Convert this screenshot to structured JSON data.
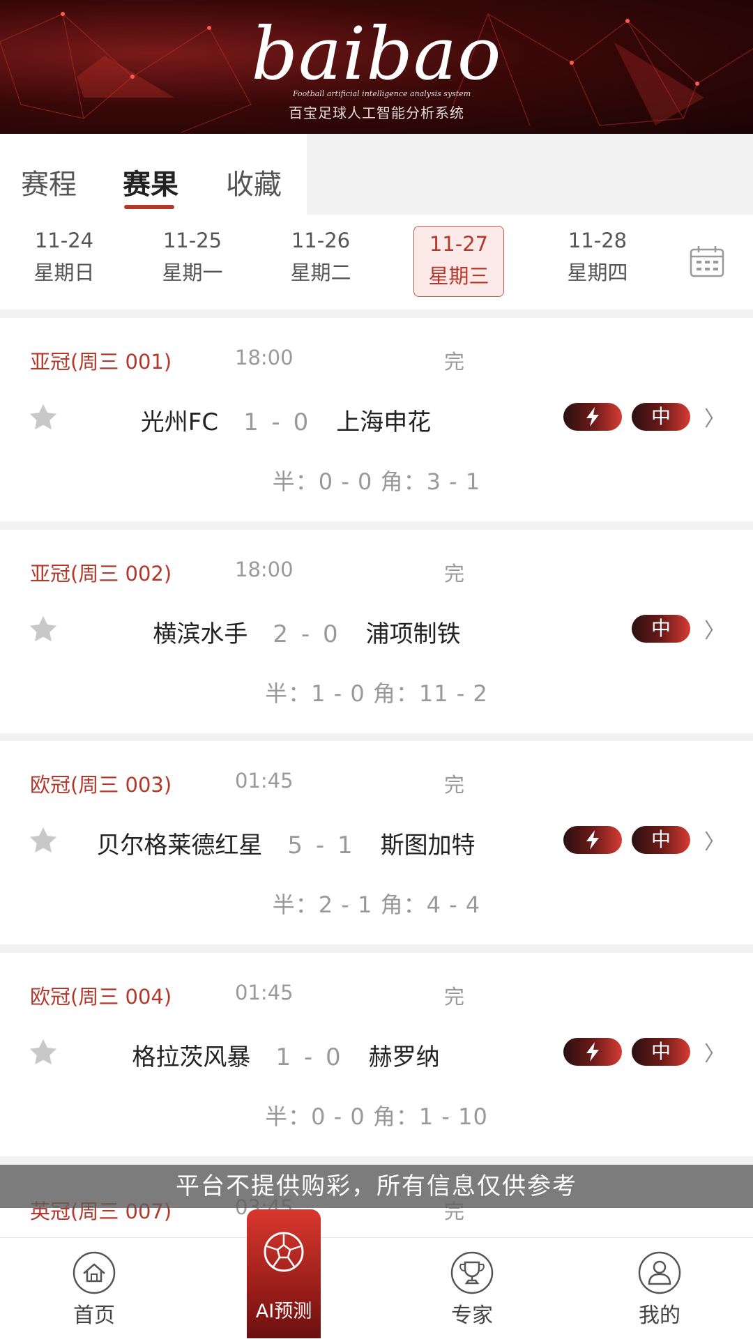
{
  "brand": {
    "logo": "baibao",
    "subtitle_en": "Football artificial intelligence analysis system",
    "subtitle_cn": "百宝足球人工智能分析系统"
  },
  "tabs": [
    {
      "label": "赛程"
    },
    {
      "label": "赛果"
    },
    {
      "label": "收藏"
    }
  ],
  "active_tab": "赛果",
  "dates": [
    {
      "date": "11-24",
      "weekday": "星期日"
    },
    {
      "date": "11-25",
      "weekday": "星期一"
    },
    {
      "date": "11-26",
      "weekday": "星期二"
    },
    {
      "date": "11-27",
      "weekday": "星期三"
    },
    {
      "date": "11-28",
      "weekday": "星期四"
    }
  ],
  "selected_date": "11-27",
  "calendar_icon": "calendar-icon",
  "matches": [
    {
      "league": "亚冠(周三 001)",
      "time": "18:00",
      "status": "完",
      "home": "光州FC",
      "score": "1 - 0",
      "away": "上海申花",
      "half": "半：0 - 0 角：3 - 1",
      "ai_badge": "lightning-icon",
      "badge": "中"
    },
    {
      "league": "亚冠(周三 002)",
      "time": "18:00",
      "status": "完",
      "home": "横滨水手",
      "score": "2 - 0",
      "away": "浦项制铁",
      "half": "半：1 - 0 角：11 - 2",
      "badge": "中"
    },
    {
      "league": "欧冠(周三 003)",
      "time": "01:45",
      "status": "完",
      "home": "贝尔格莱德红星",
      "score": "5 - 1",
      "away": "斯图加特",
      "half": "半：2 - 1 角：4 - 4",
      "ai_badge": "lightning-icon",
      "badge": "中"
    },
    {
      "league": "欧冠(周三 004)",
      "time": "01:45",
      "status": "完",
      "home": "格拉茨风暴",
      "score": "1 - 0",
      "away": "赫罗纳",
      "half": "半：0 - 0 角：1 - 10",
      "ai_badge": "lightning-icon",
      "badge": "中"
    },
    {
      "league": "英冠(周三 007)",
      "time": "03:45",
      "status": "完"
    }
  ],
  "notice": "平台不提供购彩，所有信息仅供参考",
  "nav": [
    {
      "label": "首页",
      "icon": "home-icon"
    },
    {
      "label": "AI预测",
      "icon": "soccer-ball-icon"
    },
    {
      "label": "专家",
      "icon": "trophy-icon"
    },
    {
      "label": "我的",
      "icon": "user-icon"
    }
  ],
  "colors": {
    "accent": "#b2382c",
    "banner": "#3a0808"
  }
}
